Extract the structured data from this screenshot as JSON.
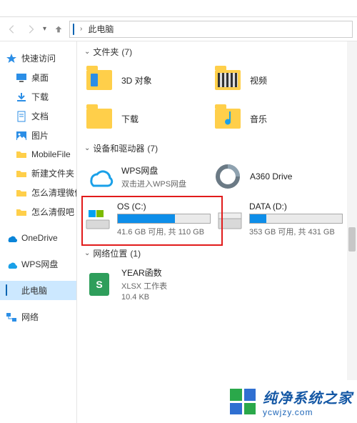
{
  "breadcrumb": {
    "location": "此电脑"
  },
  "sidebar": {
    "items": [
      {
        "label": "快速访问",
        "icon": "star-icon"
      },
      {
        "label": "桌面",
        "icon": "desktop-icon"
      },
      {
        "label": "下载",
        "icon": "download-icon"
      },
      {
        "label": "文档",
        "icon": "document-icon"
      },
      {
        "label": "图片",
        "icon": "picture-icon"
      },
      {
        "label": "MobileFile",
        "icon": "folder-icon"
      },
      {
        "label": "新建文件夹",
        "icon": "folder-icon"
      },
      {
        "label": "怎么清理微信",
        "icon": "folder-icon"
      },
      {
        "label": "怎么清假吧",
        "icon": "folder-icon"
      },
      {
        "label": "OneDrive",
        "icon": "onedrive-icon"
      },
      {
        "label": "WPS网盘",
        "icon": "wps-cloud-icon"
      },
      {
        "label": "此电脑",
        "icon": "this-pc-icon"
      },
      {
        "label": "网络",
        "icon": "network-icon"
      }
    ]
  },
  "sections": {
    "folders": {
      "title": "文件夹",
      "count": "(7)",
      "items": [
        {
          "name": "3D 对象",
          "icon": "folder-3d-icon"
        },
        {
          "name": "视频",
          "icon": "folder-video-icon"
        },
        {
          "name": "下载",
          "icon": "folder-download-icon"
        },
        {
          "name": "音乐",
          "icon": "folder-music-icon"
        }
      ]
    },
    "devices": {
      "title": "设备和驱动器",
      "count": "(7)",
      "items_top": [
        {
          "name": "WPS网盘",
          "sub": "双击进入WPS网盘",
          "icon": "wps-cloud-large-icon"
        },
        {
          "name": "A360 Drive",
          "sub": "",
          "icon": "a360-icon"
        }
      ],
      "drives": [
        {
          "name": "OS (C:)",
          "free": "41.6 GB 可用, 共 110 GB",
          "fill_pct": 62
        },
        {
          "name": "DATA (D:)",
          "free": "353 GB 可用, 共 431 GB",
          "fill_pct": 18
        }
      ]
    },
    "network": {
      "title": "网络位置",
      "count": "(1)",
      "items": [
        {
          "name": "YEAR函数",
          "line2": "XLSX 工作表",
          "line3": "10.4 KB",
          "icon": "xlsx-icon"
        }
      ]
    }
  },
  "watermark": {
    "title": "纯净系统之家",
    "url": "ycwjzy.com"
  },
  "colors": {
    "accent": "#0e8ee9",
    "highlight": "#e11b1b",
    "selection": "#cce8ff"
  }
}
